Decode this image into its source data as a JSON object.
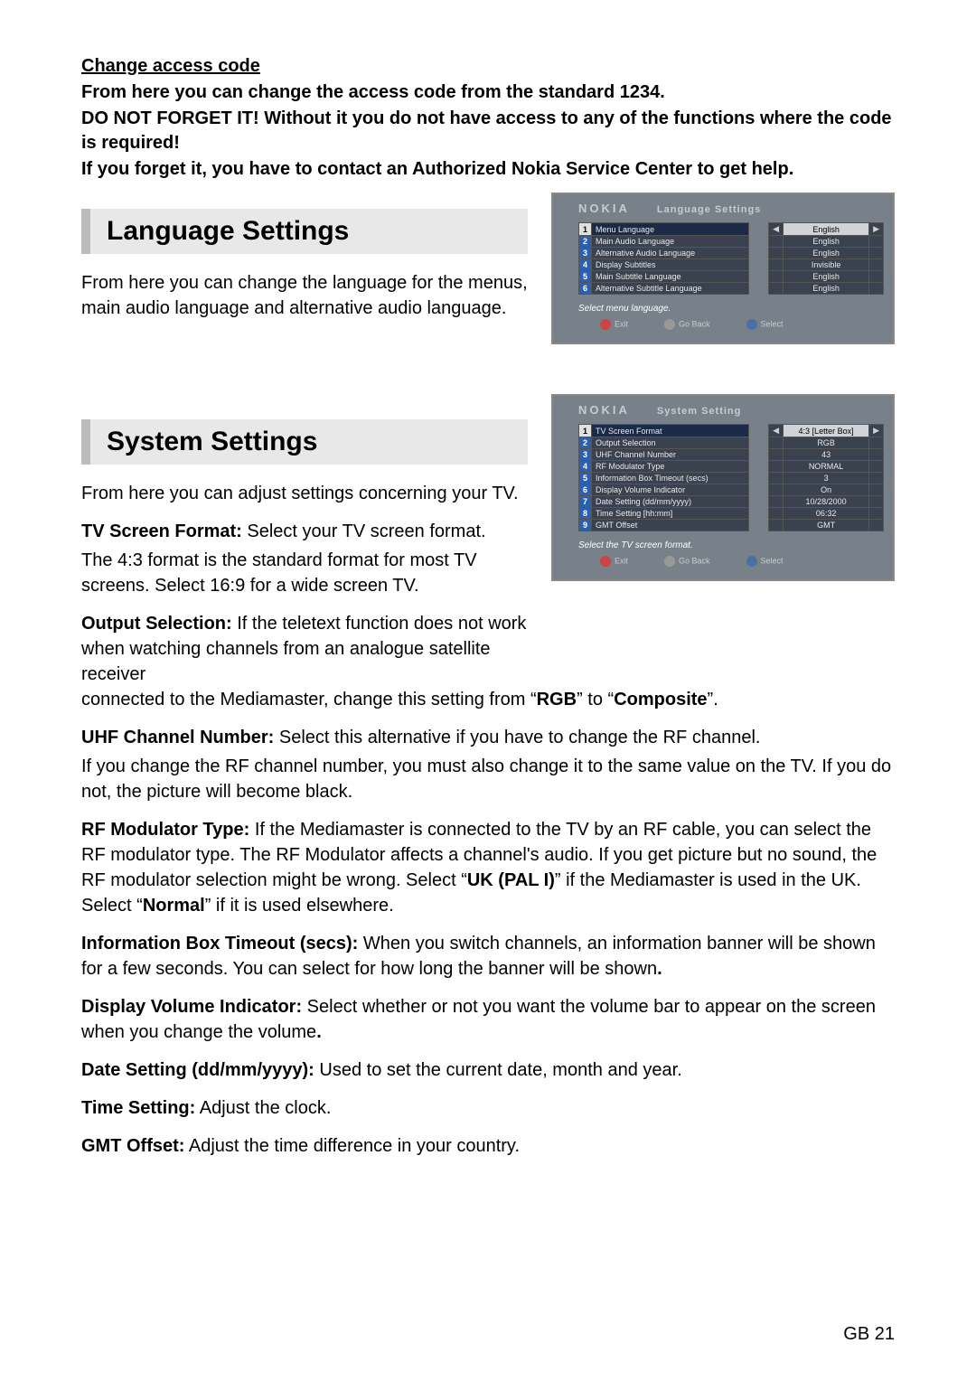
{
  "intro": {
    "heading": "Change access code",
    "p1": "From here you can change the access code from the standard 1234.",
    "p2": "DO NOT FORGET IT! Without it you do not have access to any of the functions where the code is required!",
    "p3": "If you forget it, you have to contact an Authorized Nokia Service Center to get help."
  },
  "lang_section": {
    "header": "Language Settings",
    "desc": "From here you can change the language for the menus, main audio language and alternative audio language.",
    "screenshot": {
      "brand": "NOKIA",
      "title": "Language Settings",
      "rows": [
        {
          "num": "1",
          "label": "Menu Language",
          "value": "English",
          "hi": true,
          "numBlue": false
        },
        {
          "num": "2",
          "label": "Main Audio Language",
          "value": "English",
          "hi": false,
          "numBlue": true
        },
        {
          "num": "3",
          "label": "Alternative Audio Language",
          "value": "English",
          "hi": false,
          "numBlue": true
        },
        {
          "num": "4",
          "label": "Display Subtitles",
          "value": "Invisible",
          "hi": false,
          "numBlue": true
        },
        {
          "num": "5",
          "label": "Main Subtitle Language",
          "value": "English",
          "hi": false,
          "numBlue": true
        },
        {
          "num": "6",
          "label": "Alternative Subtitle Language",
          "value": "English",
          "hi": false,
          "numBlue": true
        }
      ],
      "help": "Select menu language.",
      "buttons": {
        "exit": "Exit",
        "back": "Go Back",
        "select": "Select"
      }
    }
  },
  "sys_section": {
    "header": "System Settings",
    "desc": "From here you can adjust settings concerning your TV.",
    "tv_format_label": "TV Screen Format:",
    "tv_format_text": " Select your TV screen format.",
    "tv_format_lines": "The 4:3 format is the standard format for most TV screens. Select 16:9 for a wide screen TV.",
    "output_label": "Output Selection:",
    "output_text_a": " If the teletext function does not work when watching channels from an analogue satellite receiver",
    "output_text_b": "connected to the Mediamaster, change this setting from “",
    "rgb": "RGB",
    "output_text_c": "” to “",
    "composite": "Composite",
    "output_text_d": "”.",
    "uhf_label": "UHF Channel Number:",
    "uhf_text_a": " Select this alternative if you have to change the RF channel.",
    "uhf_text_b": "If you change the RF channel number, you must also change it to the same value on the TV. If you do not, the picture will become black.",
    "rf_label": "RF Modulator Type:",
    "rf_text_a": " If the Mediamaster is connected to the TV by an RF cable, you can select the RF modulator type. The RF Modulator affects a channel's audio. If you get picture but no sound, the RF modulator selection might be wrong. Select “",
    "ukpal": "UK (PAL I)",
    "rf_text_b": "” if the Mediamaster is used in the UK. Select “",
    "normal": "Normal",
    "rf_text_c": "” if it is used elsewhere.",
    "info_label": "Information Box Timeout (secs):",
    "info_text": " When you switch channels, an information banner will be shown for a few seconds. You can select for how long the banner will be shown",
    "vol_label": "Display Volume Indicator:",
    "vol_text": " Select whether or not you want the volume bar to appear on the screen when you change the volume",
    "date_label": "Date Setting (dd/mm/yyyy):",
    "date_text": " Used to set the current date, month and year.",
    "time_label": "Time Setting:",
    "time_text": " Adjust the clock.",
    "gmt_label": "GMT Offset:",
    "gmt_text": " Adjust the time difference in your country.",
    "screenshot": {
      "brand": "NOKIA",
      "title": "System Setting",
      "rows": [
        {
          "num": "1",
          "label": "TV Screen Format",
          "value": "4:3 [Letter Box]",
          "hi": true,
          "numBlue": false
        },
        {
          "num": "2",
          "label": "Output Selection",
          "value": "RGB",
          "hi": false,
          "numBlue": true
        },
        {
          "num": "3",
          "label": "UHF Channel Number",
          "value": "43",
          "hi": false,
          "numBlue": true
        },
        {
          "num": "4",
          "label": "RF Modulator Type",
          "value": "NORMAL",
          "hi": false,
          "numBlue": true
        },
        {
          "num": "5",
          "label": "Information Box Timeout (secs)",
          "value": "3",
          "hi": false,
          "numBlue": true
        },
        {
          "num": "6",
          "label": "Display Volume Indicator",
          "value": "On",
          "hi": false,
          "numBlue": true
        },
        {
          "num": "7",
          "label": "Date Setting (dd/mm/yyyy)",
          "value": "10/28/2000",
          "hi": false,
          "numBlue": true
        },
        {
          "num": "8",
          "label": "Time Setting [hh:mm]",
          "value": "06:32",
          "hi": false,
          "numBlue": true
        },
        {
          "num": "9",
          "label": "GMT Offset",
          "value": "GMT",
          "hi": false,
          "numBlue": true
        }
      ],
      "help": "Select the TV screen format.",
      "buttons": {
        "exit": "Exit",
        "back": "Go Back",
        "select": "Select"
      }
    }
  },
  "page_number": "GB 21"
}
